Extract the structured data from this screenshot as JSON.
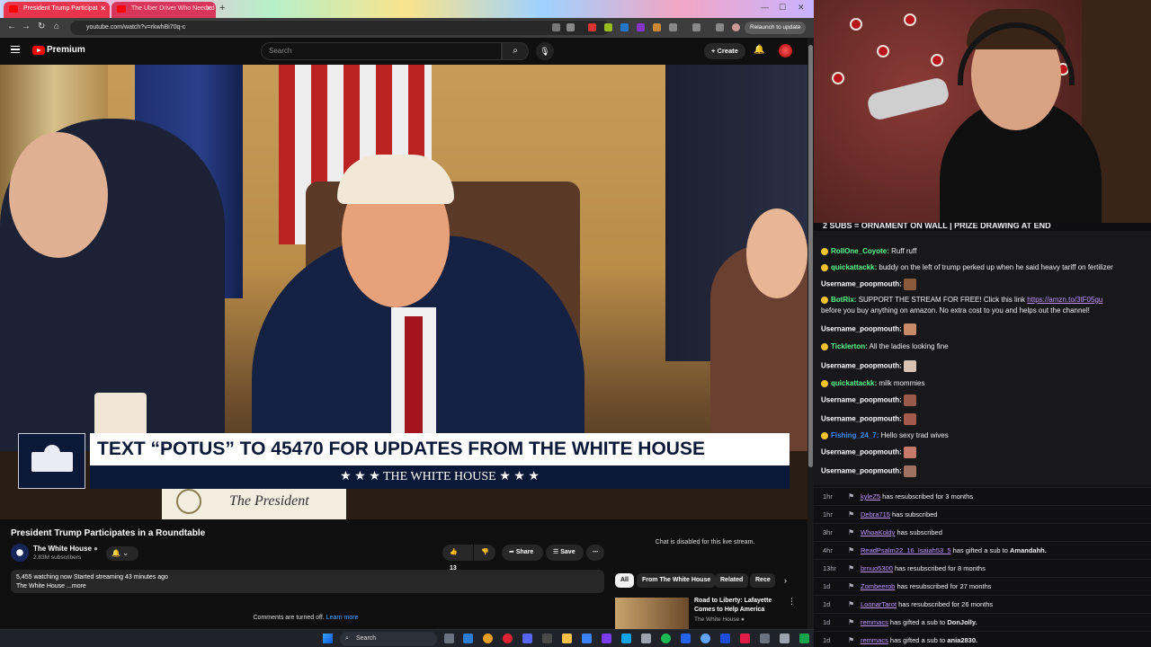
{
  "browser": {
    "tabs": [
      {
        "title": "President Trump Participat"
      },
      {
        "title": "The Uber Driver Who Needed"
      }
    ],
    "url": "youtube.com/watch?v=rkwhBi70q-c",
    "relaunch_label": "Relaunch to update"
  },
  "youtube": {
    "brand": "Premium",
    "search_placeholder": "Search",
    "create_label": "Create"
  },
  "video": {
    "banner_text": "TEXT “POTUS” TO 45470 FOR UPDATES FROM THE WHITE HOUSE",
    "banner_sub": "★ ★ ★  THE WHITE HOUSE  ★ ★ ★",
    "placard_text": "The President",
    "title": "President Trump Participates in a Roundtable",
    "channel_name": "The White House",
    "channel_subs": "2.83M subscribers",
    "like_count": "13",
    "share_label": "Share",
    "save_label": "Save",
    "description_line1": "5,455 watching now  Started streaming 43 minutes ago",
    "description_line2": "The White House ...more",
    "comments_off": "Comments are turned off.",
    "learn_more": "Learn more"
  },
  "sidebar": {
    "chat_disabled": "Chat is disabled for this live stream.",
    "chips": [
      "All",
      "From The White House",
      "Related",
      "Rece"
    ],
    "rec_title": "Road to Liberty: Lafayette Comes to Help America",
    "rec_channel": "The White House"
  },
  "stream_chat": {
    "header": "2 SUBS = ORNAMENT ON WALL | PRIZE DRAWING AT END",
    "messages": [
      {
        "user": "RollOne_Coyote",
        "text": "Ruff ruff",
        "color": "#5aff8a"
      },
      {
        "user": "quickattackk",
        "text": "buddy on the left of trump perked up when he said heavy tariff on fertilizer",
        "color": "#5aff8a"
      },
      {
        "user": "Username_poopmouth",
        "text": "",
        "color": "#ffffff"
      },
      {
        "user": "BotRix",
        "text": "SUPPORT THE STREAM FOR FREE! Click this link",
        "link": "https://amzn.to/3tF05gu",
        "text2": "before you buy anything on amazon. No extra cost to you and helps out the channel!",
        "color": "#5aff8a"
      },
      {
        "user": "Username_poopmouth",
        "text": "",
        "color": "#ffffff"
      },
      {
        "user": "Ticklerton",
        "text": "All the ladies looking fine",
        "color": "#5aff8a"
      },
      {
        "user": "Username_poopmouth",
        "text": "",
        "color": "#ffffff"
      },
      {
        "user": "quickattackk",
        "text": "milk mommies",
        "color": "#5aff8a"
      },
      {
        "user": "Username_poopmouth",
        "text": "",
        "color": "#ffffff"
      },
      {
        "user": "Username_poopmouth",
        "text": "",
        "color": "#ffffff"
      },
      {
        "user": "Fishing_24_7",
        "text": "Hello sexy trad wives",
        "color": "#3a8cff"
      },
      {
        "user": "Username_poopmouth",
        "text": "",
        "color": "#ffffff"
      },
      {
        "user": "Username_poopmouth",
        "text": "",
        "color": "#ffffff"
      }
    ]
  },
  "events": [
    {
      "time": "1hr",
      "user": "kyleZ5",
      "text": "has resubscribed for 3 months"
    },
    {
      "time": "1hr",
      "user": "Debra715",
      "text": "has subscribed"
    },
    {
      "time": "3hr",
      "user": "WhoaKoldy",
      "text": "has subscribed"
    },
    {
      "time": "4hr",
      "user": "ReadPsalm22_16_Isaiah53_5",
      "text": "has gifted a sub to",
      "target": "Amandahh."
    },
    {
      "time": "13hr",
      "user": "brnuo5300",
      "text": "has resubscribed for 8 months"
    },
    {
      "time": "1d",
      "user": "Zombeerob",
      "text": "has resubscribed for 27 months"
    },
    {
      "time": "1d",
      "user": "LoonarTarot",
      "text": "has resubscribed for 26 months"
    },
    {
      "time": "1d",
      "user": "remmacs",
      "text": "has gifted a sub to",
      "target": "DonJolly."
    },
    {
      "time": "1d",
      "user": "remmacs",
      "text": "has gifted a sub to",
      "target": "ania2830."
    }
  ],
  "taskbar": {
    "search_placeholder": "Search"
  },
  "colors": {
    "youtube_red": "#ff0000",
    "twitch_purple": "#bf94ff",
    "banner_navy": "#0b1838"
  }
}
